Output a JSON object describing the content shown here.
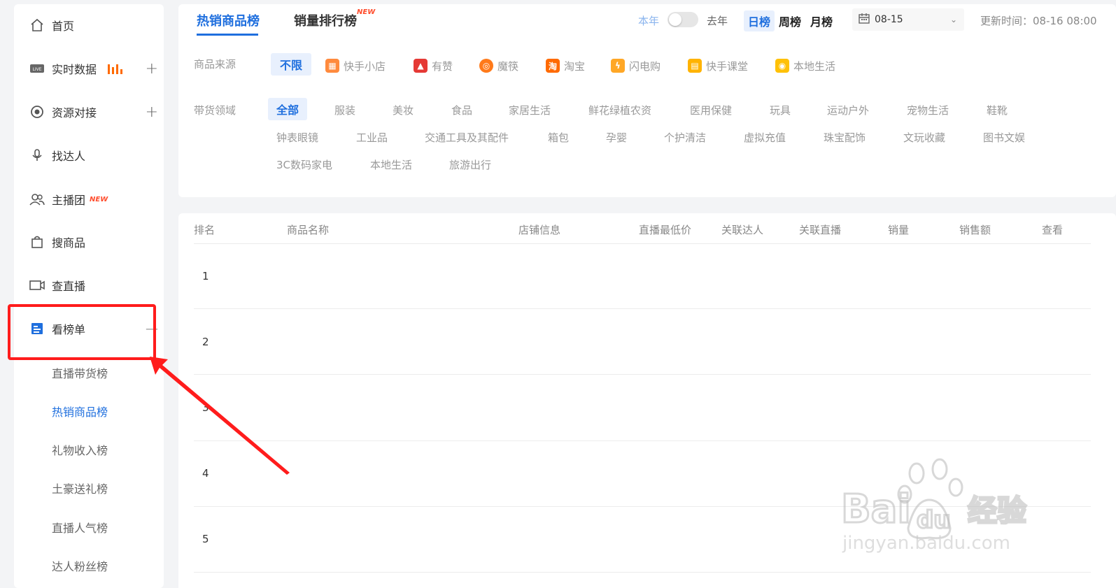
{
  "sidebar": {
    "items": [
      {
        "label": "首页",
        "icon": "home-icon"
      },
      {
        "label": "实时数据",
        "icon": "live-icon"
      },
      {
        "label": "资源对接",
        "icon": "resource-icon"
      },
      {
        "label": "找达人",
        "icon": "mic-icon"
      },
      {
        "label": "主播团",
        "icon": "group-icon",
        "badge": "NEW"
      },
      {
        "label": "搜商品",
        "icon": "bag-icon"
      },
      {
        "label": "查直播",
        "icon": "video-icon"
      },
      {
        "label": "看榜单",
        "icon": "list-icon"
      }
    ],
    "sub_items": [
      "直播带货榜",
      "热销商品榜",
      "礼物收入榜",
      "土豪送礼榜",
      "直播人气榜",
      "达人粉丝榜"
    ],
    "active_sub": "热销商品榜"
  },
  "header": {
    "tabs": [
      {
        "label": "热销商品榜"
      },
      {
        "label": "销量排行榜",
        "badge": "NEW"
      }
    ],
    "year_current": "本年",
    "year_last": "去年",
    "periods": [
      "日榜",
      "周榜",
      "月榜"
    ],
    "date": "08-15",
    "update_time": "更新时间：08-16 08:00"
  },
  "filters": {
    "source_label": "商品来源",
    "sources": [
      {
        "label": "不限"
      },
      {
        "label": "快手小店",
        "color": "#ff8a3d"
      },
      {
        "label": "有赞",
        "color": "#e53935"
      },
      {
        "label": "魔筷",
        "color": "#ff7a1a"
      },
      {
        "label": "淘宝",
        "color": "#ff6a00"
      },
      {
        "label": "闪电购",
        "color": "#ffa726"
      },
      {
        "label": "快手课堂",
        "color": "#ffb300"
      },
      {
        "label": "本地生活",
        "color": "#ffc107"
      }
    ],
    "category_label": "带货领域",
    "categories": [
      "全部",
      "服装",
      "美妆",
      "食品",
      "家居生活",
      "鲜花绿植农资",
      "医用保健",
      "玩具",
      "运动户外",
      "宠物生活",
      "鞋靴",
      "钟表眼镜",
      "工业品",
      "交通工具及其配件",
      "箱包",
      "孕婴",
      "个护清洁",
      "虚拟充值",
      "珠宝配饰",
      "文玩收藏",
      "图书文娱",
      "3C数码家电",
      "本地生活",
      "旅游出行"
    ]
  },
  "table": {
    "headers": [
      "排名",
      "商品名称",
      "店铺信息",
      "直播最低价",
      "关联达人",
      "关联直播",
      "销量",
      "销售额",
      "查看"
    ],
    "ranks": [
      "1",
      "2",
      "3",
      "4",
      "5"
    ]
  },
  "colors": {
    "accent": "#1f6fde",
    "highlight": "#ff1c1c"
  }
}
